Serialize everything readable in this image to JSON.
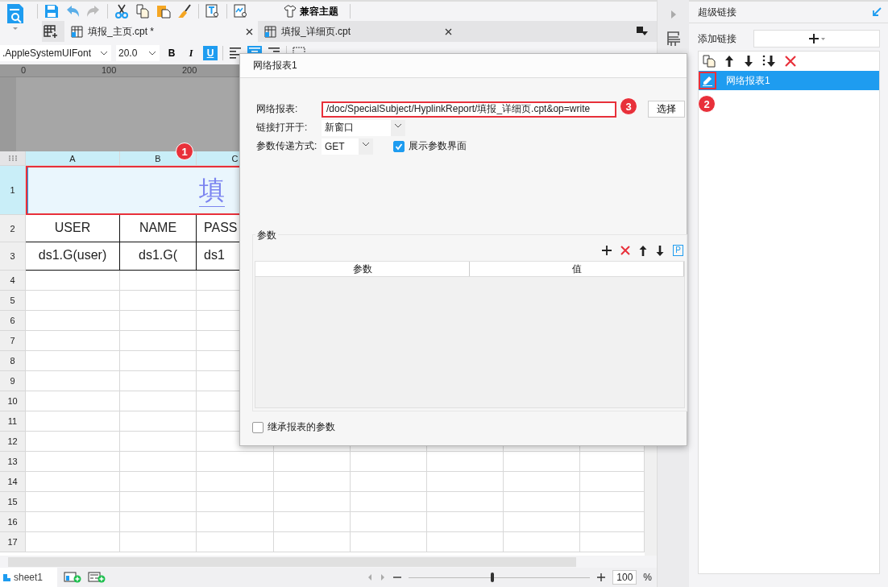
{
  "toolbar": {
    "theme_button": "兼容主题"
  },
  "tabs": [
    {
      "label": "填报_主页.cpt *",
      "selected": true
    },
    {
      "label": "填报_详细页.cpt",
      "selected": false
    }
  ],
  "format_bar": {
    "font": ".AppleSystemUIFont",
    "size": "20.0",
    "styles": [
      {
        "label": "B",
        "kind": "bold",
        "on": false
      },
      {
        "label": "I",
        "kind": "italic",
        "on": false
      },
      {
        "label": "U",
        "kind": "underline",
        "on": true
      }
    ],
    "align": [
      {
        "kind": "left",
        "selected": false
      },
      {
        "kind": "center",
        "selected": true
      },
      {
        "kind": "right",
        "selected": false
      }
    ]
  },
  "ruler": {
    "marks": [
      "0",
      "100",
      "200"
    ]
  },
  "sheet": {
    "columns": [
      "A",
      "B",
      "C"
    ],
    "rows": [
      "1",
      "2",
      "3",
      "4",
      "5",
      "6",
      "7",
      "8",
      "9",
      "10",
      "11",
      "12",
      "13",
      "14",
      "15",
      "16",
      "17"
    ],
    "title_cell": "填",
    "header_cells": [
      "USER",
      "NAME",
      "PASS"
    ],
    "data_cells": [
      "ds1.G(user)",
      "ds1.G(",
      "ds1"
    ],
    "callout": "1"
  },
  "dialog": {
    "title": "网络报表1",
    "report_label": "网络报表:",
    "report_value": "/doc/SpecialSubject/HyplinkReport/填报_详细页.cpt&op=write",
    "callout": "3",
    "choose_button": "选择",
    "open_label": "链接打开于:",
    "open_value": "新窗口",
    "method_label": "参数传递方式:",
    "method_value": "GET",
    "show_params": {
      "label": "展示参数界面",
      "checked": true
    },
    "params": {
      "title": "参数",
      "preview_button": "P",
      "columns": [
        "参数",
        "值"
      ]
    },
    "inherit": {
      "label": "继承报表的参数",
      "checked": false
    }
  },
  "side_panel": {
    "title": "超级链接",
    "add_label": "添加链接",
    "links": [
      {
        "label": "网络报表1",
        "selected": true
      }
    ],
    "callout": "2"
  },
  "status_bar": {
    "sheet_tab": "sheet1",
    "zoom_slider": {
      "level": 0.46
    },
    "zoom_value": "100",
    "zoom_unit": "%"
  }
}
